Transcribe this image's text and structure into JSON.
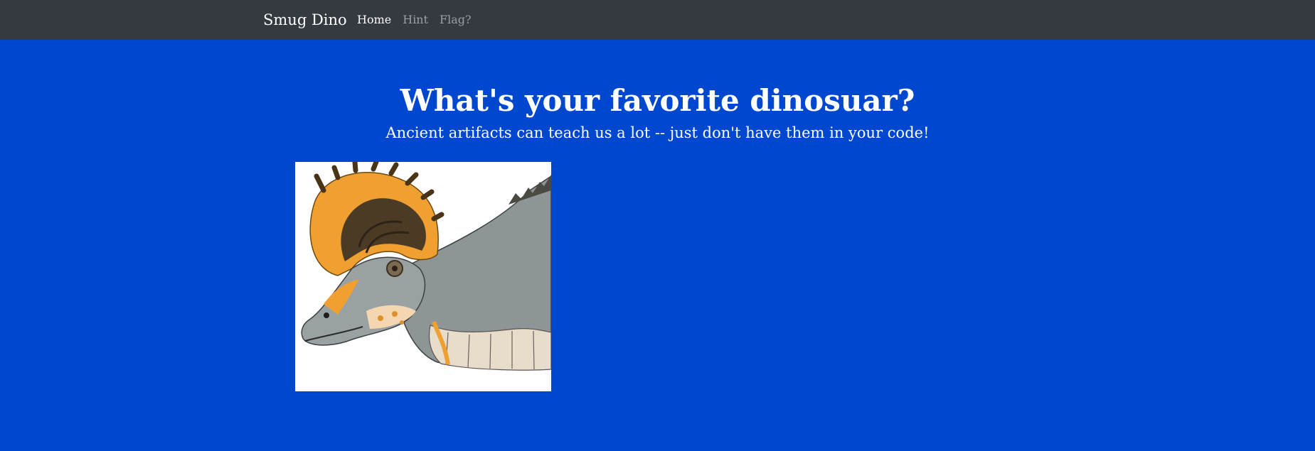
{
  "navbar": {
    "brand": "Smug Dino",
    "links": [
      {
        "label": "Home",
        "active": true
      },
      {
        "label": "Hint",
        "active": false
      },
      {
        "label": "Flag?",
        "active": false
      }
    ]
  },
  "hero": {
    "title": "What's your favorite dinosuar?",
    "subtitle": "Ancient artifacts can teach us a lot -- just don't have them in your code!"
  },
  "colors": {
    "navbar_bg": "#343a40",
    "page_bg": "#0047d0",
    "crest_orange": "#f0a030",
    "skin_gray": "#8e9596"
  },
  "image": {
    "subject": "lambeosaurus-head-illustration"
  }
}
